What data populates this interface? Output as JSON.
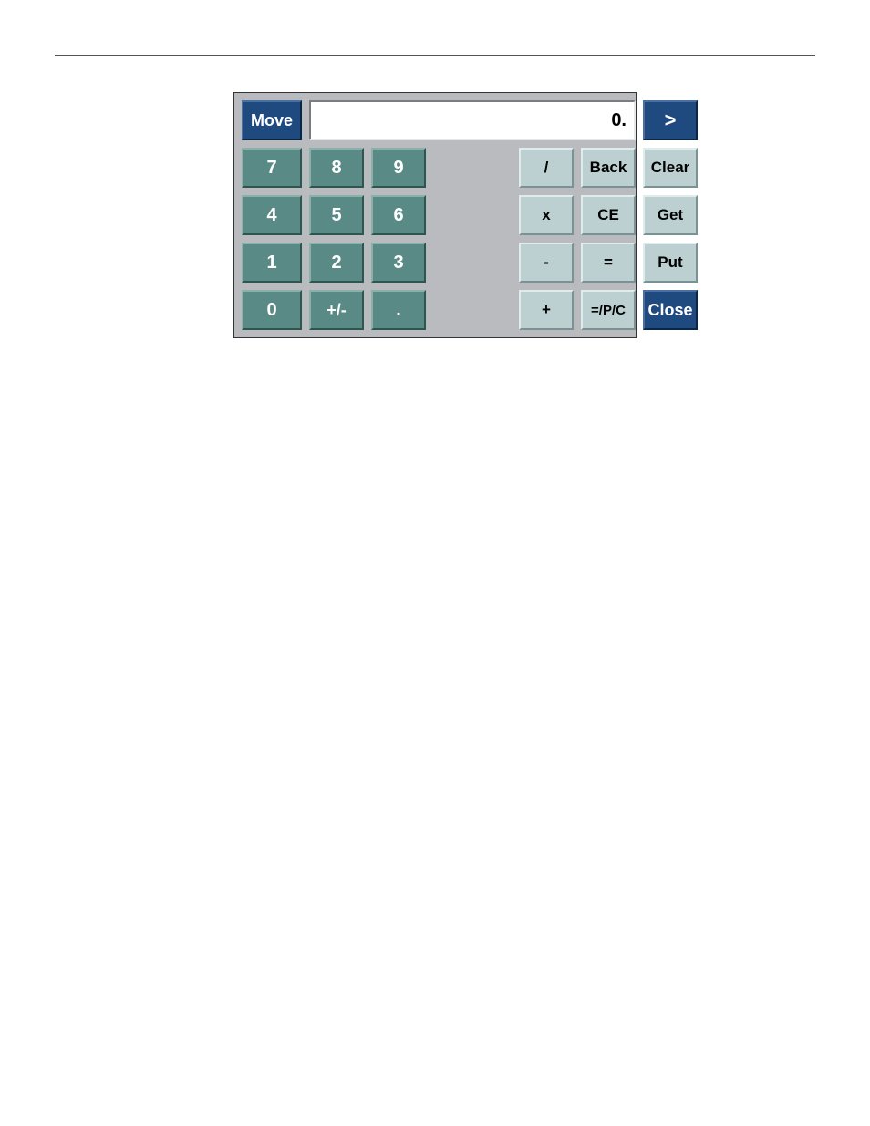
{
  "display": {
    "value": "0."
  },
  "buttons": {
    "move": "Move",
    "arrow": ">",
    "d7": "7",
    "d8": "8",
    "d9": "9",
    "d4": "4",
    "d5": "5",
    "d6": "6",
    "d1": "1",
    "d2": "2",
    "d3": "3",
    "d0": "0",
    "plusminus": "+/-",
    "dot": ".",
    "div": "/",
    "mul": "x",
    "sub": "-",
    "add": "+",
    "back": "Back",
    "ce": "CE",
    "eq": "=",
    "eqpc": "=/P/C",
    "clear": "Clear",
    "get": "Get",
    "put": "Put",
    "close": "Close"
  }
}
